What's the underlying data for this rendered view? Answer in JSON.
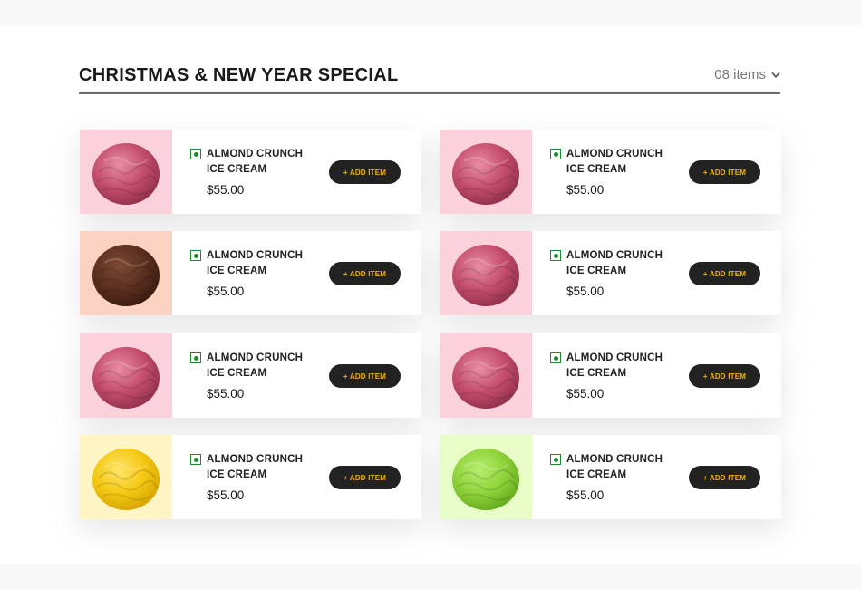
{
  "section": {
    "title": "CHRISTMAS & NEW YEAR SPECIAL",
    "count_label": "08 items",
    "count_icon": "chevron-down-icon"
  },
  "items": [
    {
      "name": "ALMOND CRUNCH ICE CREAM",
      "price": "$55.00",
      "button": "+ ADD ITEM",
      "bg": "#fbd1dc",
      "scoop": "#c44d6d",
      "scoop_dark": "#8e2f4b",
      "scoop_light": "#e88ea3"
    },
    {
      "name": "ALMOND CRUNCH ICE CREAM",
      "price": "$55.00",
      "button": "+ ADD ITEM",
      "bg": "#fbd1dc",
      "scoop": "#c44d6d",
      "scoop_dark": "#8e2f4b",
      "scoop_light": "#e88ea3"
    },
    {
      "name": "ALMOND CRUNCH ICE CREAM",
      "price": "$55.00",
      "button": "+ ADD ITEM",
      "bg": "#fbd2c2",
      "scoop": "#5b2f1f",
      "scoop_dark": "#3a1b10",
      "scoop_light": "#7d4a34"
    },
    {
      "name": "ALMOND CRUNCH ICE CREAM",
      "price": "$55.00",
      "button": "+ ADD ITEM",
      "bg": "#fbd1dc",
      "scoop": "#c44d6d",
      "scoop_dark": "#8e2f4b",
      "scoop_light": "#e88ea3"
    },
    {
      "name": "ALMOND CRUNCH ICE CREAM",
      "price": "$55.00",
      "button": "+ ADD ITEM",
      "bg": "#fbd1dc",
      "scoop": "#c44d6d",
      "scoop_dark": "#8e2f4b",
      "scoop_light": "#e88ea3"
    },
    {
      "name": "ALMOND CRUNCH ICE CREAM",
      "price": "$55.00",
      "button": "+ ADD ITEM",
      "bg": "#fbd1dc",
      "scoop": "#c44d6d",
      "scoop_dark": "#8e2f4b",
      "scoop_light": "#e88ea3"
    },
    {
      "name": "ALMOND CRUNCH ICE CREAM",
      "price": "$55.00",
      "button": "+ ADD ITEM",
      "bg": "#fff4c4",
      "scoop": "#f4c812",
      "scoop_dark": "#d4a300",
      "scoop_light": "#ffe46a"
    },
    {
      "name": "ALMOND CRUNCH ICE CREAM",
      "price": "$55.00",
      "button": "+ ADD ITEM",
      "bg": "#e8fcc8",
      "scoop": "#8fd33a",
      "scoop_dark": "#64a81e",
      "scoop_light": "#b8ee6e"
    }
  ],
  "colors": {
    "button_bg": "#222222",
    "button_text": "#f5b301",
    "veg_mark": "#1a8a2e",
    "divider": "#6d6d6d"
  }
}
